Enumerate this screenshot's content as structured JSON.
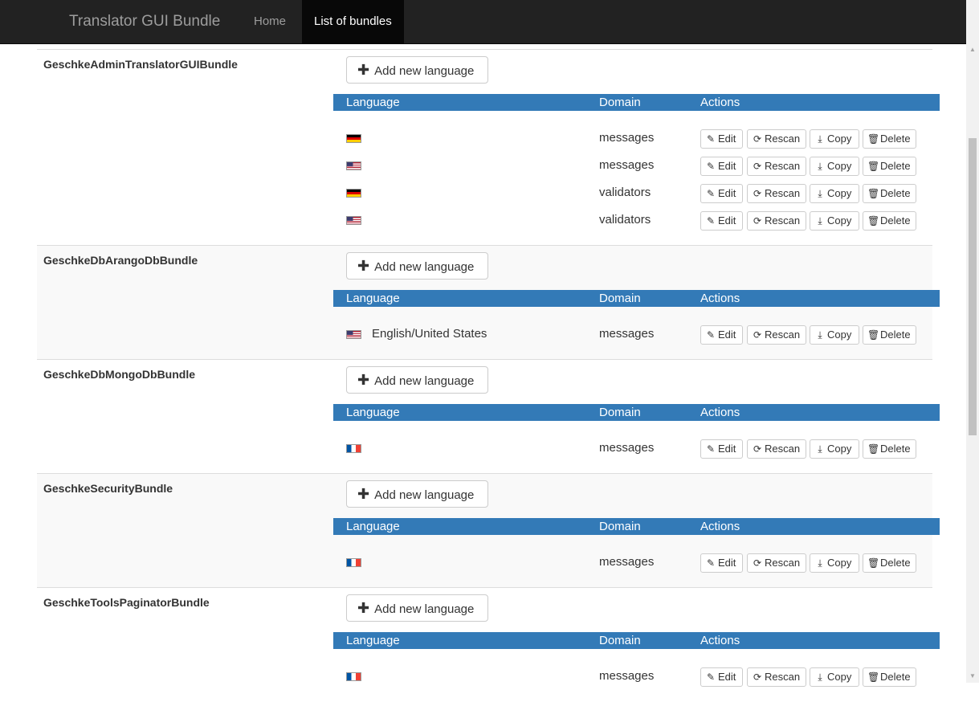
{
  "navbar": {
    "brand": "Translator GUI Bundle",
    "links": [
      {
        "label": "Home",
        "active": false
      },
      {
        "label": "List of bundles",
        "active": true
      }
    ]
  },
  "labels": {
    "add_language": "Add new language",
    "col_language": "Language",
    "col_domain": "Domain",
    "col_actions": "Actions",
    "edit": "Edit",
    "rescan": "Rescan",
    "copy": "Copy",
    "delete": "Delete"
  },
  "icons": {
    "add": "plus-icon",
    "edit": "pencil-icon",
    "rescan": "refresh-icon",
    "copy": "download-icon",
    "delete": "trash-icon"
  },
  "colors": {
    "navbar_bg": "#222222",
    "active_nav_bg": "#080808",
    "table_header_bg": "#337ab7",
    "alt_row_bg": "#f9f9f9"
  },
  "bundles": [
    {
      "name": "GeschkeAdminTranslatorGUIBundle",
      "rows": [
        {
          "flag": "de",
          "language": "",
          "domain": "messages"
        },
        {
          "flag": "us",
          "language": "",
          "domain": "messages"
        },
        {
          "flag": "de",
          "language": "",
          "domain": "validators"
        },
        {
          "flag": "us",
          "language": "",
          "domain": "validators"
        }
      ]
    },
    {
      "name": "GeschkeDbArangoDbBundle",
      "rows": [
        {
          "flag": "us",
          "language": "English/United States",
          "domain": "messages"
        }
      ]
    },
    {
      "name": "GeschkeDbMongoDbBundle",
      "rows": [
        {
          "flag": "fr",
          "language": "",
          "domain": "messages"
        }
      ]
    },
    {
      "name": "GeschkeSecurityBundle",
      "rows": [
        {
          "flag": "fr",
          "language": "",
          "domain": "messages"
        }
      ]
    },
    {
      "name": "GeschkeToolsPaginatorBundle",
      "rows": [
        {
          "flag": "fr",
          "language": "",
          "domain": "messages"
        }
      ]
    }
  ]
}
